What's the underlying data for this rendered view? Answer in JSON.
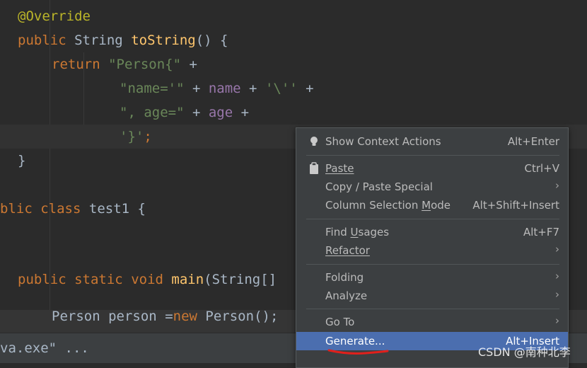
{
  "code": {
    "line1": {
      "annotation": "@Override"
    },
    "line2": {
      "kw": "public",
      "type": "String",
      "method": "toString",
      "rest": "() {"
    },
    "line3": {
      "kw": "return",
      "str": "\"Person{\"",
      "op": " +"
    },
    "line4": {
      "str1": "\"name='\"",
      "op1": " + ",
      "field": "name",
      "op2": " + ",
      "str2": "'\\''",
      "op3": " +"
    },
    "line5": {
      "str": "\", age=\"",
      "op1": " + ",
      "field": "age",
      "op2": " +"
    },
    "line6": {
      "str": "'}'",
      "semi": ";"
    },
    "line7": {
      "brace": "}"
    },
    "line8": {
      "lead": "blic",
      "kw": "class",
      "name": "test1",
      "brace": "{"
    },
    "line9": {
      "kw1": "public",
      "kw2": "static",
      "kw3": "void",
      "method": "main",
      "rest": "(String[]"
    },
    "line10": {
      "type": "Person",
      "var": "person",
      "eq": "=",
      "kw": "new",
      "ctor": "Person",
      "rest": "();"
    }
  },
  "statusbar": {
    "text": "va.exe\" ..."
  },
  "context_menu": {
    "items": [
      {
        "label": "Show Context Actions",
        "shortcut": "Alt+Enter",
        "icon": "lightbulb-icon"
      },
      {
        "label": "Paste",
        "shortcut": "Ctrl+V",
        "icon": "clipboard-icon"
      },
      {
        "label": "Copy / Paste Special",
        "submenu": "›"
      },
      {
        "label_pre": "Column Selection ",
        "label_u": "M",
        "label_post": "ode",
        "shortcut": "Alt+Shift+Insert"
      },
      {
        "label_pre": "Find ",
        "label_u": "U",
        "label_post": "sages",
        "shortcut": "Alt+F7"
      },
      {
        "label": "Refactor",
        "submenu": "›"
      },
      {
        "label": "Folding",
        "submenu": "›"
      },
      {
        "label": "Analyze",
        "submenu": "›"
      },
      {
        "label": "Go To",
        "submenu": "›"
      },
      {
        "label": "Generate...",
        "shortcut": "Alt+Insert"
      }
    ]
  },
  "watermark": "CSDN @南种北李",
  "colors": {
    "editor_bg": "#2b2b2b",
    "menu_bg": "#3c3f41",
    "selection": "#4b6eaf",
    "keyword": "#cc7832",
    "string": "#6a8759",
    "method": "#ffc66d",
    "annotation": "#bbb529",
    "field": "#9876aa",
    "red_mark": "#e0201c"
  }
}
